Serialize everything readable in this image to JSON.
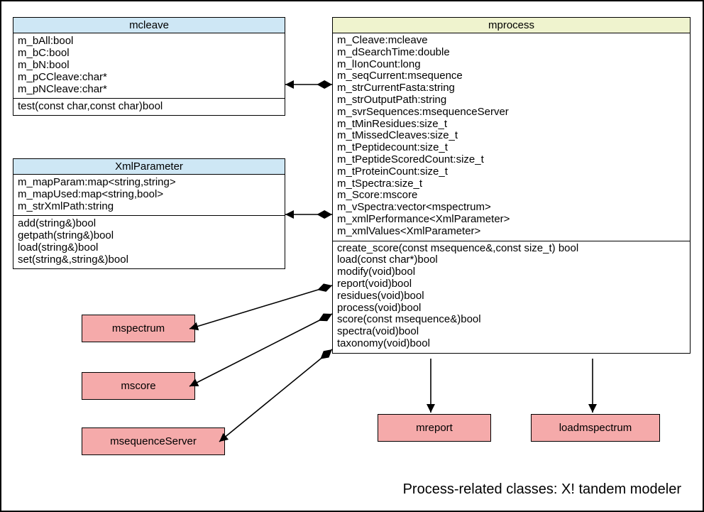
{
  "caption": "Process-related classes: X! tandem modeler",
  "classes": {
    "mcleave": {
      "name": "mcleave",
      "attrs": [
        "m_bAll:bool",
        "m_bC:bool",
        "m_bN:bool",
        "m_pCCleave:char*",
        "m_pNCleave:char*"
      ],
      "ops": [
        "test(const char,const char)bool"
      ]
    },
    "XmlParameter": {
      "name": "XmlParameter",
      "attrs": [
        "m_mapParam:map<string,string>",
        "m_mapUsed:map<string,bool>",
        "m_strXmlPath:string"
      ],
      "ops": [
        "add(string&)bool",
        "getpath(string&)bool",
        "load(string&)bool",
        "set(string&,string&)bool"
      ]
    },
    "mprocess": {
      "name": "mprocess",
      "attrs": [
        "m_Cleave:mcleave",
        "m_dSearchTime:double",
        "m_lIonCount:long",
        "m_seqCurrent:msequence",
        "m_strCurrentFasta:string",
        "m_strOutputPath:string",
        "m_svrSequences:msequenceServer",
        "m_tMinResidues:size_t",
        "m_tMissedCleaves:size_t",
        "m_tPeptidecount:size_t",
        "m_tPeptideScoredCount:size_t",
        "m_tProteinCount:size_t",
        "m_tSpectra:size_t",
        "m_Score:mscore",
        "m_vSpectra:vector<mspectrum>",
        "m_xmlPerformance<XmlParameter>",
        "m_xmlValues<XmlParameter>"
      ],
      "ops": [
        "create_score(const msequence&,const size_t) bool",
        "load(const char*)bool",
        "modify(void)bool",
        "report(void)bool",
        "residues(void)bool",
        "process(void)bool",
        "score(const msequence&)bool",
        "spectra(void)bool",
        "taxonomy(void)bool"
      ]
    }
  },
  "simple": {
    "mspectrum": "mspectrum",
    "mscore": "mscore",
    "msequenceServer": "msequenceServer",
    "mreport": "mreport",
    "loadmspectrum": "loadmspectrum"
  }
}
